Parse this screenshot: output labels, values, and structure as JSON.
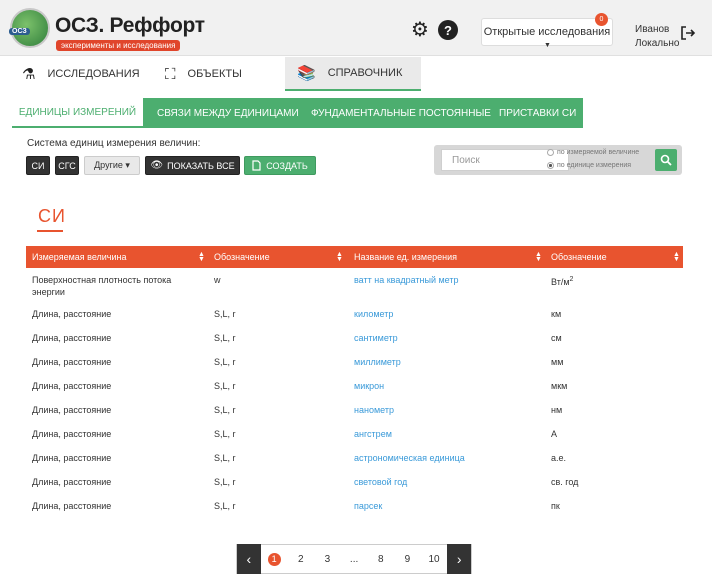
{
  "header": {
    "logo_badge": "ОСЗ",
    "brand_title": "ОСЗ. Реффорт",
    "brand_subtitle": "эксперименты и исследования",
    "open_studies_label": "Открытые исследования",
    "open_studies_count": "0",
    "user_name": "Иванов",
    "user_mode": "Локально"
  },
  "mainnav": {
    "items": [
      {
        "label": "ИССЛЕДОВАНИЯ",
        "icon": "flask-icon"
      },
      {
        "label": "ОБЪЕКТЫ",
        "icon": "expand-icon"
      },
      {
        "label": "СПРАВОЧНИК",
        "icon": "books-icon"
      }
    ]
  },
  "subtabs": [
    {
      "label": "ЕДИНИЦЫ ИЗМЕРЕНИЙ"
    },
    {
      "label": "СВЯЗИ МЕЖДУ ЕДИНИЦАМИ"
    },
    {
      "label": "ФУНДАМЕНТАЛЬНЫЕ ПОСТОЯННЫЕ"
    },
    {
      "label": "ПРИСТАВКИ СИ"
    }
  ],
  "controls": {
    "system_label": "Система единиц измерения величин:",
    "si_label": "СИ",
    "cgs_label": "СГС",
    "others_label": "Другие ▾",
    "show_all_label": "ПОКАЗАТЬ ВСЕ",
    "create_label": "СОЗДАТЬ"
  },
  "search": {
    "placeholder": "Поиск",
    "option1": "по измеряемой величине",
    "option2": "по единице измерения"
  },
  "section": {
    "title": "СИ"
  },
  "table": {
    "headers": [
      "Измеряемая величина",
      "Обозначение",
      "Название ед. измерения",
      "Обозначение"
    ],
    "rows": [
      {
        "quantity": "Поверхностная плотность потока энергии",
        "symbol": "w",
        "unit": "ватт на квадратный метр",
        "unit_symbol": "Вт/м",
        "unit_sup": "2"
      },
      {
        "quantity": "Длина, расстояние",
        "symbol": "S,L, r",
        "unit": "километр",
        "unit_symbol": "км"
      },
      {
        "quantity": "Длина, расстояние",
        "symbol": "S,L, r",
        "unit": "сантиметр",
        "unit_symbol": "см"
      },
      {
        "quantity": "Длина, расстояние",
        "symbol": "S,L, r",
        "unit": "миллиметр",
        "unit_symbol": "мм"
      },
      {
        "quantity": "Длина, расстояние",
        "symbol": "S,L, r",
        "unit": "микрон",
        "unit_symbol": "мкм"
      },
      {
        "quantity": "Длина, расстояние",
        "symbol": "S,L, r",
        "unit": "нанометр",
        "unit_symbol": "нм"
      },
      {
        "quantity": "Длина, расстояние",
        "symbol": "S,L, r",
        "unit": "ангстрем",
        "unit_symbol": "A"
      },
      {
        "quantity": "Длина, расстояние",
        "symbol": "S,L, r",
        "unit": "астрономическая единица",
        "unit_symbol": "а.е."
      },
      {
        "quantity": "Длина, расстояние",
        "symbol": "S,L, r",
        "unit": "световой год",
        "unit_symbol": "св. год"
      },
      {
        "quantity": "Длина, расстояние",
        "symbol": "S,L, r",
        "unit": "парсек",
        "unit_symbol": "пк"
      }
    ]
  },
  "pagination": {
    "current": "1",
    "pages": [
      "2",
      "3",
      "...",
      "8",
      "9",
      "10"
    ],
    "prev": "‹",
    "next": "›"
  },
  "colors": {
    "accent_orange": "#e8542f",
    "accent_green": "#4cae6f",
    "link_blue": "#3a9ad9"
  }
}
